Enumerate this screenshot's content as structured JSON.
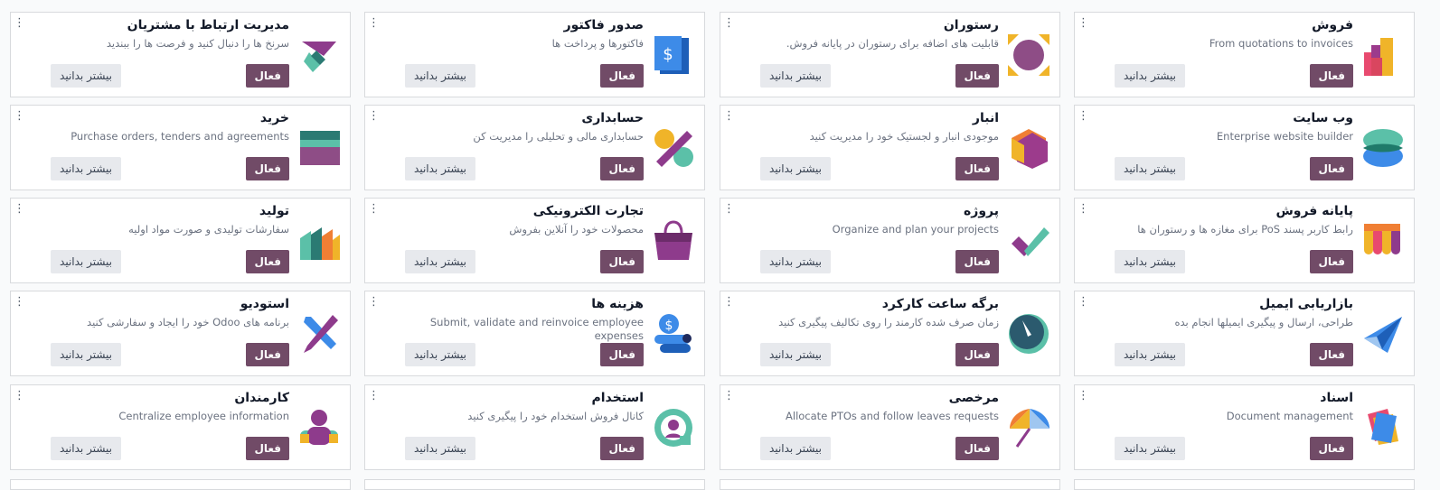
{
  "buttons": {
    "activate": "فعال",
    "learn_more": "بیشتر بدانید",
    "kebab": "⋮"
  },
  "apps": [
    {
      "title": "فروش",
      "summary": "From quotations to invoices",
      "ltr": true,
      "icon": "sales-icon"
    },
    {
      "title": "رستوران",
      "summary": "قابلیت های اضافه برای رستوران در پایانه فروش.",
      "ltr": false,
      "icon": "restaurant-icon"
    },
    {
      "title": "صدور فاکتور",
      "summary": "فاکتورها و پرداخت ها",
      "ltr": false,
      "icon": "invoicing-icon"
    },
    {
      "title": "مدیریت ارتباط با مشتریان",
      "summary": "سرنخ ها را دنبال کنید و فرصت ها را ببندید",
      "ltr": false,
      "icon": "crm-icon"
    },
    {
      "title": "وب سایت",
      "summary": "Enterprise website builder",
      "ltr": true,
      "icon": "website-icon"
    },
    {
      "title": "انبار",
      "summary": "موجودی انبار و لجستیک خود را مدیریت کنید",
      "ltr": false,
      "icon": "inventory-icon"
    },
    {
      "title": "حسابداری",
      "summary": "حسابداری مالی و تحلیلی را مدیریت کن",
      "ltr": false,
      "icon": "accounting-icon"
    },
    {
      "title": "خرید",
      "summary": "Purchase orders, tenders and agreements",
      "ltr": true,
      "icon": "purchase-icon"
    },
    {
      "title": "پایانه فروش",
      "summary": "رابط کاربر پسند PoS برای مغازه ها و رستوران ها",
      "ltr": false,
      "icon": "point-of-sale-icon"
    },
    {
      "title": "پروژه",
      "summary": "Organize and plan your projects",
      "ltr": true,
      "icon": "project-icon"
    },
    {
      "title": "تجارت الکترونیکی",
      "summary": "محصولات خود را آنلاین بفروش",
      "ltr": false,
      "icon": "ecommerce-icon"
    },
    {
      "title": "تولید",
      "summary": "سفارشات تولیدی و صورت مواد اولیه",
      "ltr": false,
      "icon": "manufacturing-icon"
    },
    {
      "title": "بازاریابی ایمیل",
      "summary": "طراحی، ارسال و پیگیری ایمیلها انجام بده",
      "ltr": false,
      "icon": "email-marketing-icon"
    },
    {
      "title": "برگه ساعت کارکرد",
      "summary": "زمان صرف شده کارمند را روی تکالیف پیگیری کنید",
      "ltr": false,
      "icon": "timesheets-icon"
    },
    {
      "title": "هزینه ها",
      "summary": "Submit, validate and reinvoice employee expenses",
      "ltr": true,
      "icon": "expenses-icon"
    },
    {
      "title": "استودیو",
      "summary": "برنامه های Odoo خود را ایجاد و سفارشی کنید",
      "ltr": false,
      "icon": "studio-icon"
    },
    {
      "title": "اسناد",
      "summary": "Document management",
      "ltr": true,
      "icon": "documents-icon"
    },
    {
      "title": "مرخصی",
      "summary": "Allocate PTOs and follow leaves requests",
      "ltr": true,
      "icon": "time-off-icon"
    },
    {
      "title": "استخدام",
      "summary": "کانال فروش استخدام خود را پیگیری کنید",
      "ltr": false,
      "icon": "recruitment-icon"
    },
    {
      "title": "کارمندان",
      "summary": "Centralize employee information",
      "ltr": true,
      "icon": "employees-icon"
    }
  ],
  "colors": {
    "activate_bg": "#714b67",
    "info_bg": "#e7e9ed",
    "card_border": "#d8dadd"
  }
}
